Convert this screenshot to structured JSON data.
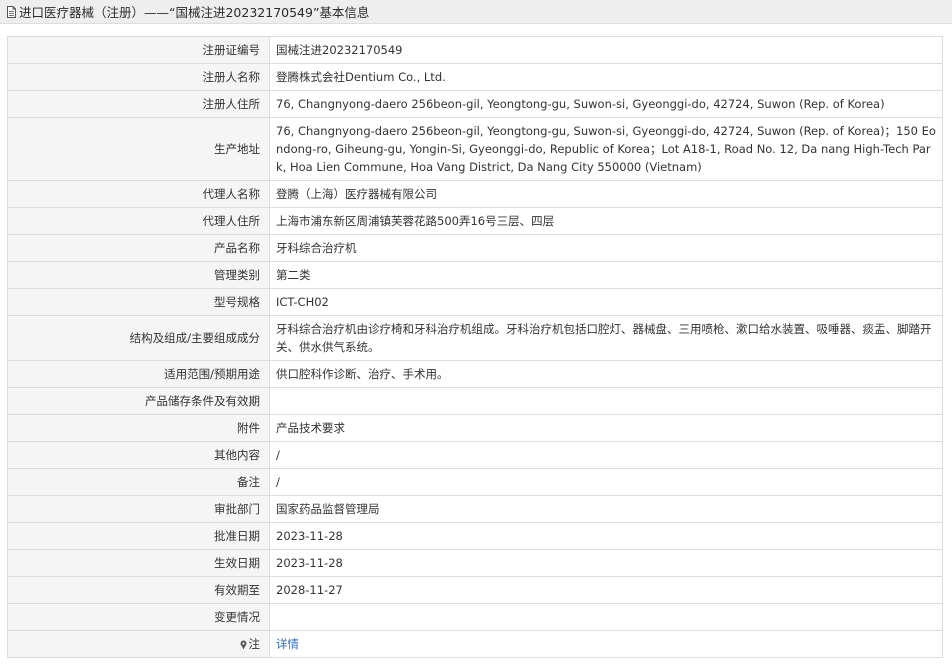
{
  "header": {
    "title": "进口医疗器械（注册）——“国械注进20232170549”基本信息"
  },
  "rows": [
    {
      "label": "注册证编号",
      "value": "国械注进20232170549"
    },
    {
      "label": "注册人名称",
      "value": "登腾株式会社Dentium Co., Ltd."
    },
    {
      "label": "注册人住所",
      "value": "76, Changnyong-daero 256beon-gil, Yeongtong-gu, Suwon-si, Gyeonggi-do, 42724, Suwon (Rep. of Korea)"
    },
    {
      "label": "生产地址",
      "value": "76, Changnyong-daero 256beon-gil, Yeongtong-gu, Suwon-si, Gyeonggi-do, 42724, Suwon (Rep. of Korea)；150 Eondong-ro, Giheung-gu, Yongin-Si, Gyeonggi-do, Republic of Korea；Lot A18-1, Road No. 12, Da nang High-Tech Park, Hoa Lien Commune, Hoa Vang District, Da Nang City 550000 (Vietnam)"
    },
    {
      "label": "代理人名称",
      "value": "登腾（上海）医疗器械有限公司"
    },
    {
      "label": "代理人住所",
      "value": "上海市浦东新区周浦镇芙蓉花路500弄16号三层、四层"
    },
    {
      "label": "产品名称",
      "value": "牙科综合治疗机"
    },
    {
      "label": "管理类别",
      "value": "第二类"
    },
    {
      "label": "型号规格",
      "value": "ICT-CH02"
    },
    {
      "label": "结构及组成/主要组成成分",
      "value": "牙科综合治疗机由诊疗椅和牙科治疗机组成。牙科治疗机包括口腔灯、器械盘、三用喷枪、漱口给水装置、吸唾器、痰盂、脚踏开关、供水供气系统。"
    },
    {
      "label": "适用范围/预期用途",
      "value": "供口腔科作诊断、治疗、手术用。"
    },
    {
      "label": "产品储存条件及有效期",
      "value": ""
    },
    {
      "label": "附件",
      "value": "产品技术要求"
    },
    {
      "label": "其他内容",
      "value": "/"
    },
    {
      "label": "备注",
      "value": "/"
    },
    {
      "label": "审批部门",
      "value": "国家药品监督管理局"
    },
    {
      "label": "批准日期",
      "value": "2023-11-28"
    },
    {
      "label": "生效日期",
      "value": "2023-11-28"
    },
    {
      "label": "有效期至",
      "value": "2028-11-27"
    },
    {
      "label": "变更情况",
      "value": ""
    }
  ],
  "note_row": {
    "label": "注",
    "link_text": "详情"
  },
  "colors": {
    "link": "#2b6cc4",
    "label_bg": "#f5f5f5",
    "border": "#dcdcdc",
    "title_bg": "#eeeeee"
  }
}
